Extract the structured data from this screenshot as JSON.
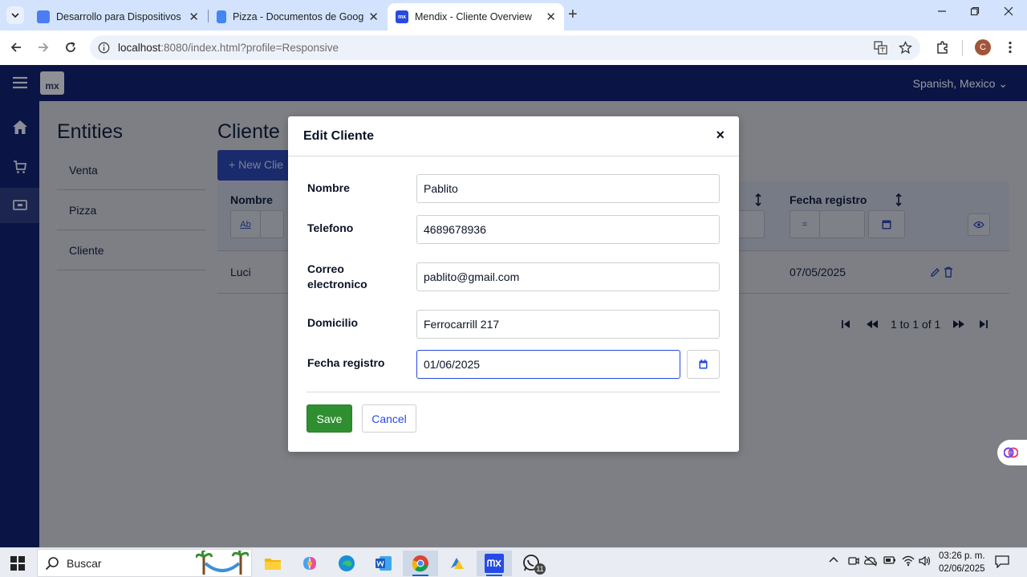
{
  "browser": {
    "tabs": [
      {
        "title": "Desarrollo para Dispositivos Int",
        "favicon_color": "#4a7cf3"
      },
      {
        "title": "Pizza - Documentos de Google",
        "favicon_color": "#4285f4"
      },
      {
        "title": "Mendix - Cliente Overview",
        "favicon_color": "#264ae5",
        "favicon_text": "mx"
      }
    ],
    "url_host": "localhost",
    "url_rest": ":8080/index.html?profile=Responsive",
    "profile_initial": "C"
  },
  "app": {
    "logo": "mx",
    "language": "Spanish, Mexico",
    "entities_title": "Entities",
    "entities": [
      "Venta",
      "Pizza",
      "Cliente"
    ],
    "page_title": "Cliente",
    "new_button": "+ New Clie",
    "grid": {
      "headers": [
        "Nombre",
        "Fecha registro"
      ],
      "filter_label": "Ab",
      "filter_eq": "=",
      "row": {
        "nombre": "Luci",
        "fecha": "07/05/2025"
      }
    },
    "pager_text": "1 to 1 of 1"
  },
  "modal": {
    "title": "Edit Cliente",
    "close": "×",
    "fields": [
      {
        "label": "Nombre",
        "value": "Pablito"
      },
      {
        "label": "Telefono",
        "value": "4689678936"
      },
      {
        "label": "Correo electronico",
        "value": "pablito@gmail.com"
      },
      {
        "label": "Domicilio",
        "value": "Ferrocarrill 217"
      },
      {
        "label": "Fecha registro",
        "value": "01/06/2025"
      }
    ],
    "save": "Save",
    "cancel": "Cancel"
  },
  "taskbar": {
    "search": "Buscar",
    "whatsapp_badge": "11",
    "time": "03:26 p. m.",
    "date": "02/06/2025"
  },
  "colors": {
    "app_topbar": "#0a1545",
    "primary": "#264ae5",
    "save": "#2f8f30",
    "tabbar": "#d3e3fd"
  }
}
